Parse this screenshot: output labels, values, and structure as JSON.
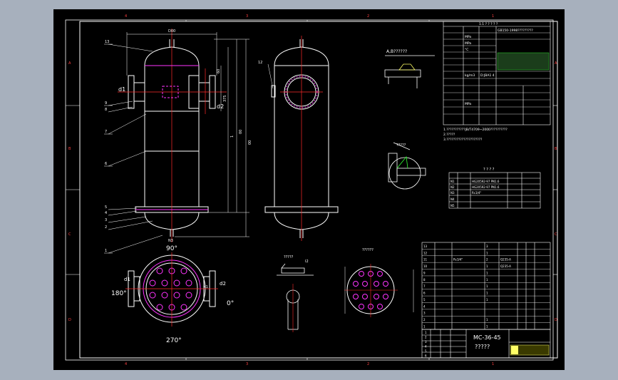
{
  "colors": {
    "background": "#a7b0bd",
    "sheet": "#000000",
    "line": "#ffffff",
    "accent_red": "#ff2a2a",
    "accent_magenta": "#ff33ff",
    "accent_cyan": "#00ffff",
    "accent_yellow": "#ffff66",
    "accent_green": "#33ff33"
  },
  "border": {
    "top_zones": [
      "4",
      "3",
      "2",
      "1"
    ],
    "bottom_zones": [
      "4",
      "3",
      "2",
      "1"
    ],
    "left_zones": [
      "A",
      "B",
      "C",
      "D"
    ],
    "right_zones": [
      "A",
      "B",
      "C",
      "D"
    ]
  },
  "front_view": {
    "label_left": "d1",
    "label_right": "d2",
    "leaders": [
      "13",
      "9",
      "8",
      "7",
      "6",
      "5",
      "4",
      "3",
      "2",
      "1"
    ],
    "dim_top": "D00",
    "dims_right": [
      "60",
      "375",
      "1",
      "00",
      "00"
    ],
    "bottom_tag": "N3"
  },
  "side_view": {
    "tag": "12"
  },
  "plan_view": {
    "angle_top": "90°",
    "angle_left": "180°",
    "angle_right": "0°",
    "angle_bottom": "270°",
    "label_left": "d1",
    "label_right": "d2",
    "center_tag": "N1"
  },
  "detail_a": {
    "title": "A,B??????"
  },
  "detail_weld": {
    "title": "?????"
  },
  "detail_small": {
    "title": "?????",
    "tag": "I2"
  },
  "detail_flange": {
    "title": "??????"
  },
  "tech_table": {
    "title": "1.1 ? ? ? ? ?",
    "rows": [
      [
        "",
        "",
        "",
        "GB150-1998?????????"
      ],
      [
        "",
        "MPa",
        "",
        ""
      ],
      [
        "",
        "MPa",
        "",
        ""
      ],
      [
        "",
        "°C",
        "",
        ""
      ],
      [
        "",
        "",
        "",
        ""
      ],
      [
        "",
        "",
        "",
        ""
      ],
      [
        "",
        "",
        "",
        ""
      ],
      [
        "",
        "",
        "",
        ""
      ],
      [
        "",
        "kg/m3",
        "",
        "D:JBA1 4"
      ],
      [
        "",
        "",
        "",
        ""
      ],
      [
        "",
        "",
        "",
        ""
      ],
      [
        "",
        "",
        "",
        ""
      ],
      [
        "",
        "MPa",
        "",
        ""
      ],
      [
        "",
        "",
        "",
        ""
      ]
    ]
  },
  "notes": [
    "1.???????????JB/T4709~2000??????????",
    "2.?????",
    "3.?????????????????????"
  ],
  "nozzle_table": {
    "title": "? ? ? ?",
    "rows": [
      [
        "N1",
        "",
        "HG20592-97 PN1.6",
        ""
      ],
      [
        "N2",
        "",
        "HG20592-97 PN1.6",
        ""
      ],
      [
        "N3",
        "",
        "Rc3/4\"",
        ""
      ],
      [
        "N4",
        "",
        "",
        ""
      ],
      [
        "N5",
        "",
        "",
        ""
      ]
    ]
  },
  "bom_table": {
    "rows": [
      [
        "13",
        "",
        "",
        "3",
        "",
        "",
        "",
        ""
      ],
      [
        "12",
        "",
        "",
        "1",
        "",
        "",
        "",
        ""
      ],
      [
        "11",
        "",
        "Rc3/4\"",
        "2",
        "Q235-A",
        "",
        "",
        ""
      ],
      [
        "10",
        "",
        "",
        "1",
        "Q235-A",
        "",
        "",
        ""
      ],
      [
        "9",
        "",
        "",
        "1",
        "",
        "",
        "",
        ""
      ],
      [
        "8",
        "",
        "",
        "1",
        "",
        "",
        "",
        ""
      ],
      [
        "7",
        "",
        "",
        "1",
        "",
        "",
        "",
        ""
      ],
      [
        "6",
        "",
        "",
        "1",
        "",
        "",
        "",
        ""
      ],
      [
        "5",
        "",
        "",
        "1",
        "",
        "",
        "",
        ""
      ],
      [
        "4",
        "",
        "",
        "",
        "",
        "",
        "",
        ""
      ],
      [
        "3",
        "",
        "",
        "",
        "",
        "",
        "",
        ""
      ],
      [
        "2",
        "",
        "",
        "1",
        "",
        "",
        "",
        ""
      ],
      [
        "1",
        "",
        "",
        "1",
        "",
        "",
        "",
        ""
      ]
    ]
  },
  "title_block": {
    "drawing_no": "MC-36-45",
    "drawing_name": "?????",
    "left_cols": [
      "1",
      "2",
      "3",
      "4",
      "5",
      "6"
    ]
  }
}
